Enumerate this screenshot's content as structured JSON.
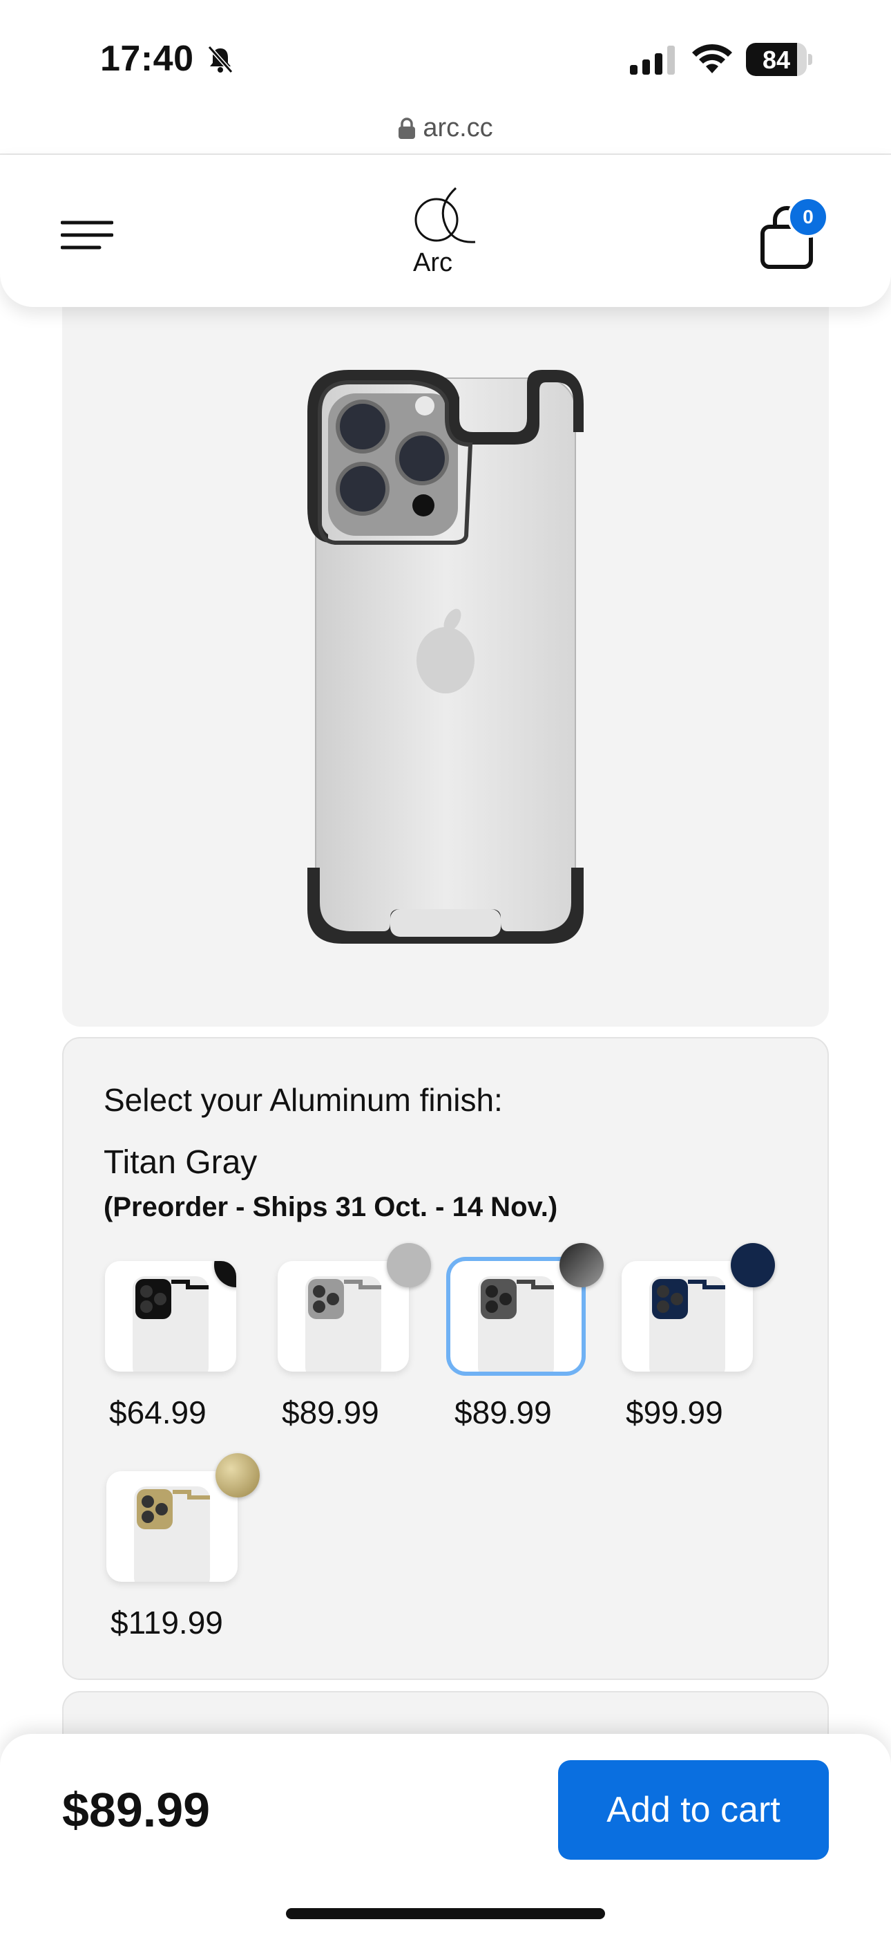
{
  "status_bar": {
    "time": "17:40",
    "battery": "84",
    "battery_level": 0.84
  },
  "url_bar": {
    "url": "arc.cc"
  },
  "header": {
    "logo_text": "Arc",
    "cart_count": "0"
  },
  "finish": {
    "label": "Select your Aluminum finish:",
    "selected_name": "Titan Gray",
    "shipping_note": "(Preorder - Ships 31 Oct. - 14 Nov.)",
    "options": [
      {
        "price": "$64.99",
        "color": "#111111",
        "selected": false
      },
      {
        "price": "$89.99",
        "color": "#b9b9b9",
        "selected": false
      },
      {
        "price": "$89.99",
        "color": "#3a3a3a",
        "selected": true
      },
      {
        "price": "$99.99",
        "color": "#12264a",
        "selected": false
      },
      {
        "price": "$119.99",
        "color": "#b8a46a",
        "selected": false
      }
    ]
  },
  "bottom_bar": {
    "price": "$89.99",
    "add_to_cart_label": "Add to cart"
  },
  "colors": {
    "accent": "#0a6fe0",
    "card_bg": "#f3f3f3"
  }
}
